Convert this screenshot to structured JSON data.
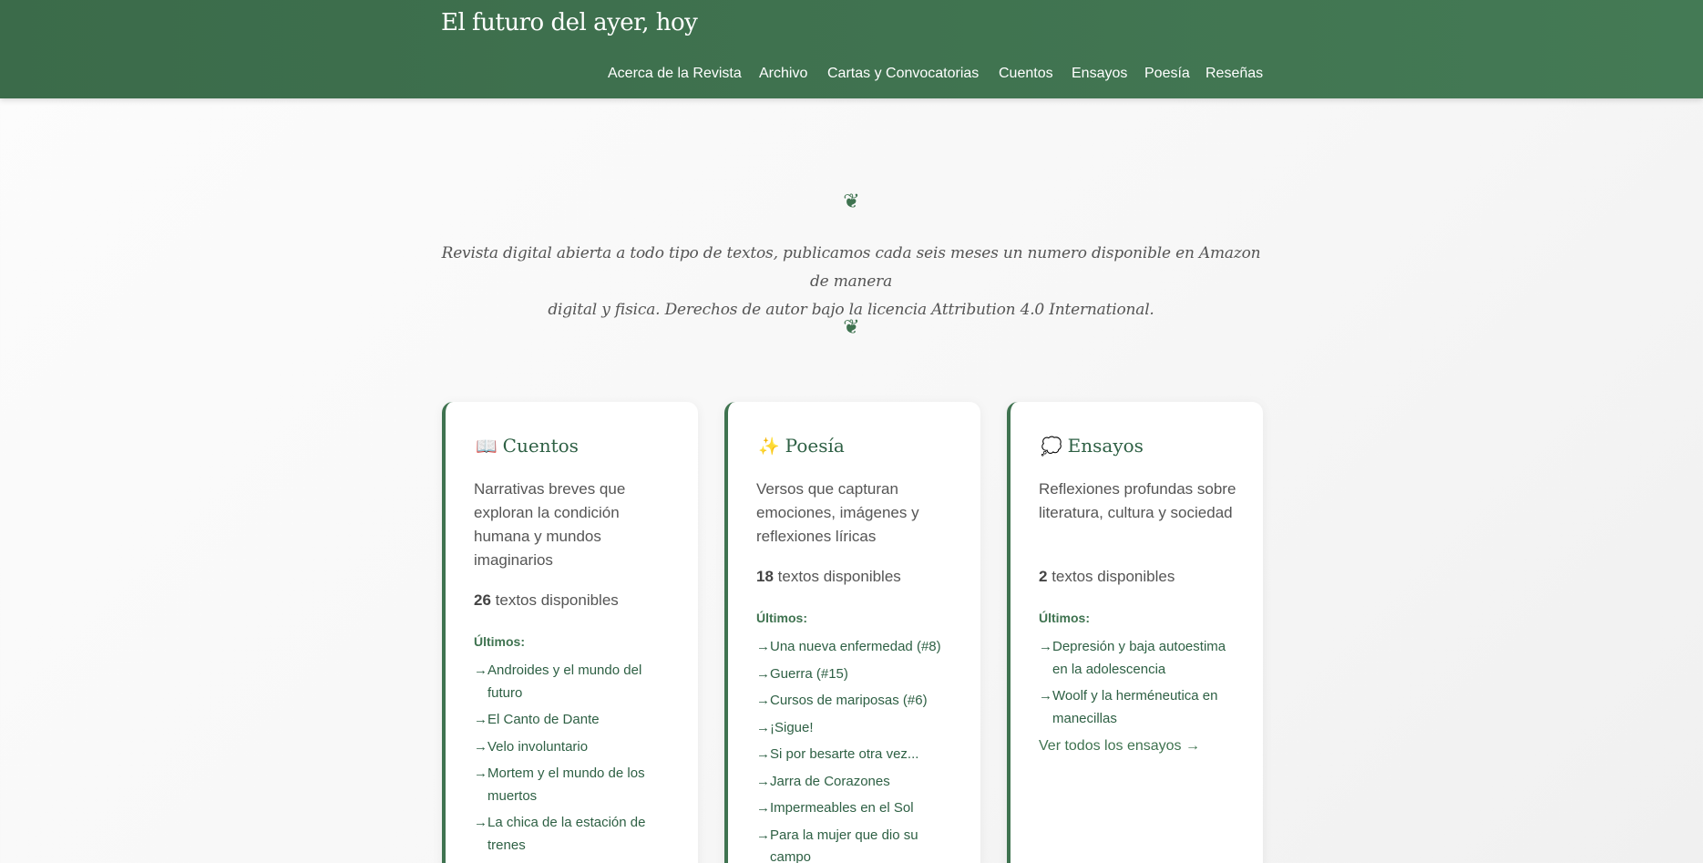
{
  "header": {
    "site_title": "El futuro del ayer, hoy",
    "nav": [
      {
        "label": "Acerca de la Revista"
      },
      {
        "label": "Archivo"
      },
      {
        "label": "Cartas y Convocatorias"
      },
      {
        "label": "Cuentos"
      },
      {
        "label": "Ensayos"
      },
      {
        "label": "Poesía"
      },
      {
        "label": "Reseñas"
      }
    ]
  },
  "hero": {
    "ornament": "❦",
    "tagline_line1": "Revista digital abierta a todo tipo de textos, publicamos cada seis meses un numero disponible en Amazon de manera",
    "tagline_line2": "digital y fisica. Derechos de autor bajo la licencia Attribution 4.0 International."
  },
  "cards": [
    {
      "emoji": "📖",
      "title": "Cuentos",
      "description": "Narrativas breves que exploran la condición humana y mundos imaginarios",
      "count": "26",
      "count_suffix": " textos disponibles",
      "latest_label": "Últimos:",
      "arrow": "→",
      "latest": [
        "Androides y el mundo del futuro",
        "El Canto de Dante",
        "Velo involuntario",
        "Mortem y el mundo de los muertos",
        "La chica de la estación de trenes"
      ]
    },
    {
      "emoji": "✨",
      "title": "Poesía",
      "description": "Versos que capturan emociones, imágenes y reflexiones líricas",
      "count": "18",
      "count_suffix": " textos disponibles",
      "latest_label": "Últimos:",
      "arrow": "→",
      "latest": [
        "Una nueva enfermedad (#8)",
        "Guerra (#15)",
        "Cursos de mariposas (#6)",
        "¡Sigue!",
        "Si por besarte otra vez...",
        "Jarra de Corazones",
        "Impermeables en el Sol",
        "Para la mujer que dio su campo"
      ]
    },
    {
      "emoji": "💭",
      "title": "Ensayos",
      "description": "Reflexiones profundas sobre literatura, cultura y sociedad",
      "count": "2",
      "count_suffix": " textos disponibles",
      "latest_label": "Últimos:",
      "arrow": "→",
      "latest": [
        "Depresión y baja autoestima en la adolescencia",
        "Woolf y la herméneutica en manecillas"
      ],
      "view_all": "Ver todos los ensayos →"
    }
  ]
}
